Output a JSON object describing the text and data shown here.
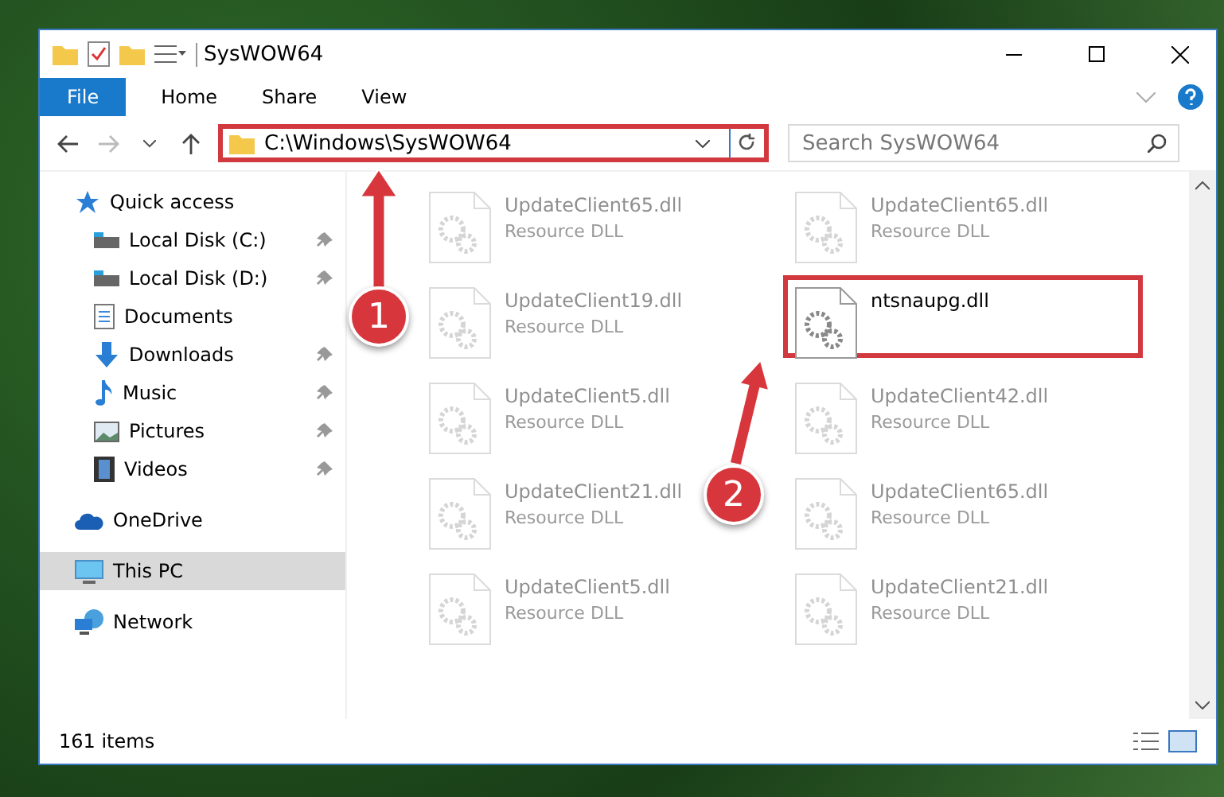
{
  "window": {
    "title": "SysWOW64"
  },
  "ribbon_tabs": [
    {
      "label": "File",
      "selected": true
    },
    {
      "label": "Home",
      "selected": false
    },
    {
      "label": "Share",
      "selected": false
    },
    {
      "label": "View",
      "selected": false
    }
  ],
  "address_bar": {
    "path": "C:\\Windows\\SysWOW64",
    "highlighted": true
  },
  "search": {
    "placeholder": "Search SysWOW64"
  },
  "sidebar": {
    "items": [
      {
        "label": "Quick access",
        "kind": "star",
        "selected": false,
        "children": [
          {
            "label": "Local Disk (C:)",
            "kind": "drive",
            "pinned": true,
            "selected": false
          },
          {
            "label": "Local Disk (D:)",
            "kind": "drive",
            "pinned": true,
            "selected": false
          },
          {
            "label": "Documents",
            "kind": "document",
            "pinned": false,
            "selected": false
          },
          {
            "label": "Downloads",
            "kind": "download",
            "pinned": true,
            "selected": false
          },
          {
            "label": "Music",
            "kind": "music",
            "pinned": true,
            "selected": false
          },
          {
            "label": "Pictures",
            "kind": "picture",
            "pinned": true,
            "selected": false
          },
          {
            "label": "Videos",
            "kind": "video",
            "pinned": true,
            "selected": false
          }
        ]
      },
      {
        "label": "OneDrive",
        "kind": "cloud",
        "selected": false
      },
      {
        "label": "This PC",
        "kind": "pc",
        "selected": true
      },
      {
        "label": "Network",
        "kind": "network",
        "selected": false
      }
    ]
  },
  "files": [
    {
      "name": "UpdateClient65.dll",
      "type": "Resource DLL",
      "faded": true,
      "highlighted": false
    },
    {
      "name": "UpdateClient65.dll",
      "type": "Resource DLL",
      "faded": true,
      "highlighted": false
    },
    {
      "name": "UpdateClient19.dll",
      "type": "Resource DLL",
      "faded": true,
      "highlighted": false
    },
    {
      "name": "ntsnaupg.dll",
      "faded": false,
      "highlighted": true
    },
    {
      "name": "UpdateClient5.dll",
      "type": "Resource DLL",
      "faded": true,
      "highlighted": false
    },
    {
      "name": "UpdateClient42.dll",
      "type": "Resource DLL",
      "faded": true,
      "highlighted": false
    },
    {
      "name": "UpdateClient21.dll",
      "type": "Resource DLL",
      "faded": true,
      "highlighted": false
    },
    {
      "name": "UpdateClient65.dll",
      "type": "Resource DLL",
      "faded": true,
      "highlighted": false
    },
    {
      "name": "UpdateClient5.dll",
      "type": "Resource DLL",
      "faded": true,
      "highlighted": false
    },
    {
      "name": "UpdateClient21.dll",
      "type": "Resource DLL",
      "faded": true,
      "highlighted": false
    }
  ],
  "status_bar": {
    "item_count": "161 items"
  },
  "callouts": [
    {
      "number": "1"
    },
    {
      "number": "2"
    }
  ]
}
